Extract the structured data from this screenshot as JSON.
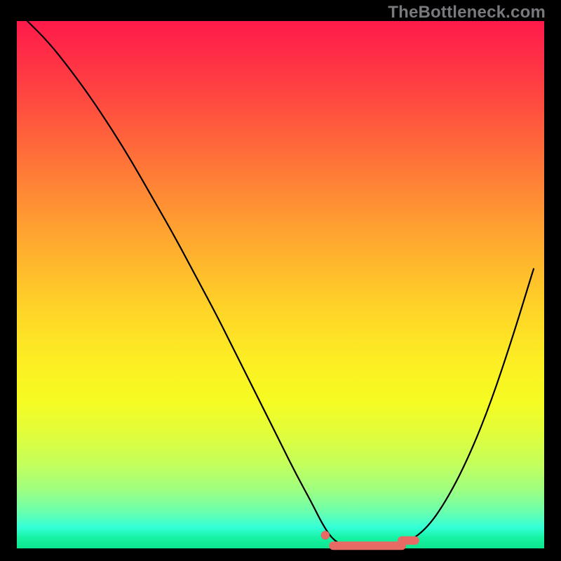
{
  "watermark": "TheBottleneck.com",
  "colors": {
    "frame": "#000000",
    "curve": "#000000",
    "marker_fill": "#e86a64",
    "marker_stroke": "#d35b55"
  },
  "chart_data": {
    "type": "line",
    "title": "",
    "xlabel": "",
    "ylabel": "",
    "xlim": [
      0,
      100
    ],
    "ylim": [
      0,
      100
    ],
    "series": [
      {
        "name": "bottleneck-curve",
        "x": [
          2,
          6,
          10,
          14,
          18,
          22,
          26,
          30,
          34,
          38,
          42,
          46,
          50,
          53,
          56,
          58,
          60,
          63,
          66,
          70,
          74,
          78,
          82,
          86,
          90,
          94,
          98
        ],
        "values": [
          100,
          96,
          91,
          85.5,
          79.5,
          73,
          66,
          59,
          51.5,
          44,
          36,
          28,
          20,
          14,
          8.5,
          4.5,
          1.5,
          0,
          0,
          0,
          1,
          4,
          10,
          18,
          28,
          40,
          53
        ]
      }
    ],
    "markers": [
      {
        "shape": "dot",
        "x": 58.5,
        "y": 2.5
      },
      {
        "shape": "segment",
        "x0": 60,
        "x1": 73,
        "y": 0.5
      },
      {
        "shape": "segment",
        "x0": 73,
        "x1": 75.5,
        "y": 1.5
      }
    ],
    "background": {
      "style": "vertical-gradient",
      "stops": [
        {
          "t": 0.0,
          "c": "#ff1a4b"
        },
        {
          "t": 0.34,
          "c": "#ff8e34"
        },
        {
          "t": 0.64,
          "c": "#fced23"
        },
        {
          "t": 0.88,
          "c": "#9dff81"
        },
        {
          "t": 1.0,
          "c": "#0de58e"
        }
      ]
    }
  }
}
